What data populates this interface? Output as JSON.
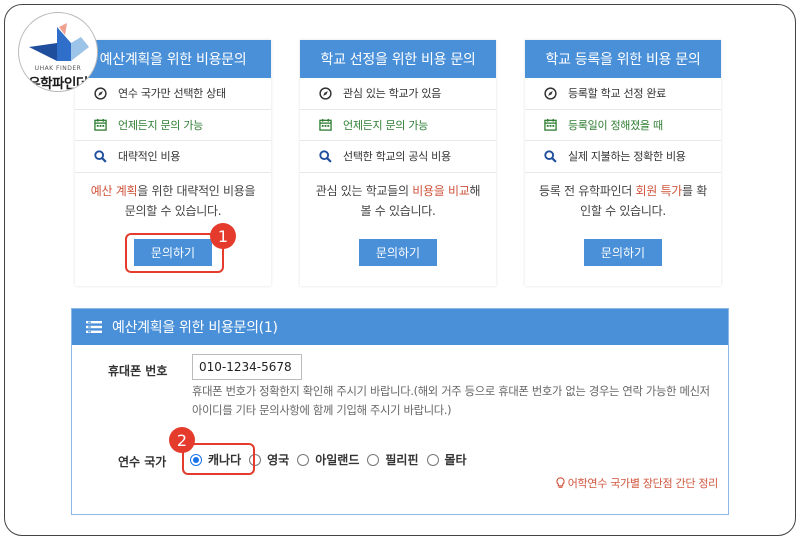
{
  "logo": {
    "sub": "UHAK FINDER",
    "name": "유학파인더"
  },
  "cards": [
    {
      "title": "예산계획을 위한 비용문의",
      "rows": [
        "연수 국가만 선택한 상태",
        "언제든지 문의 가능",
        "대략적인 비용"
      ],
      "desc": {
        "pre": "",
        "hl": "예산 계획",
        "mid": "을 위한 대략적인 비용을 문의할 수 있습니다.",
        "hl2": "",
        "post": ""
      },
      "button": "문의하기"
    },
    {
      "title": "학교 선정을 위한 비용 문의",
      "rows": [
        "관심 있는 학교가 있음",
        "언제든지 문의 가능",
        "선택한 학교의 공식 비용"
      ],
      "desc": {
        "pre": "관심 있는 학교들의 ",
        "hl": "비용을 비교",
        "mid": "해 볼 수 있습니다.",
        "hl2": "",
        "post": ""
      },
      "button": "문의하기"
    },
    {
      "title": "학교 등록을 위한 비용 문의",
      "rows": [
        "등록할 학교 선정 완료",
        "등록일이 정해졌을 때",
        "실제 지불하는 정확한 비용"
      ],
      "desc": {
        "pre": "등록 전 유학파인더 ",
        "hl": "회원 특가",
        "mid": "를 확인할 수 있습니다.",
        "hl2": "",
        "post": ""
      },
      "button": "문의하기"
    }
  ],
  "annotations": {
    "badge1": "1",
    "badge2": "2"
  },
  "form": {
    "title": "예산계획을 위한 비용문의(1)",
    "phone_label": "휴대폰 번호",
    "phone_value": "010-1234-5678",
    "phone_help": "휴대폰 번호가 정확한지 확인해 주시기 바랍니다.(해외 거주 등으로 휴대폰 번호가 없는 경우는 연락 가능한 메신저 아이디를 기타 문의사항에 함께 기입해 주시기 바랍니다.)",
    "country_label": "연수 국가",
    "countries": [
      "캐나다",
      "영국",
      "아일랜드",
      "필리핀",
      "몰타"
    ],
    "selected_country": "캐나다",
    "tip": "어학연수 국가별 장단점 간단 정리"
  },
  "colors": {
    "accent": "#4a90d9",
    "highlight": "#d0553c",
    "annotation": "#e53b2c",
    "green": "#2e7d32"
  }
}
